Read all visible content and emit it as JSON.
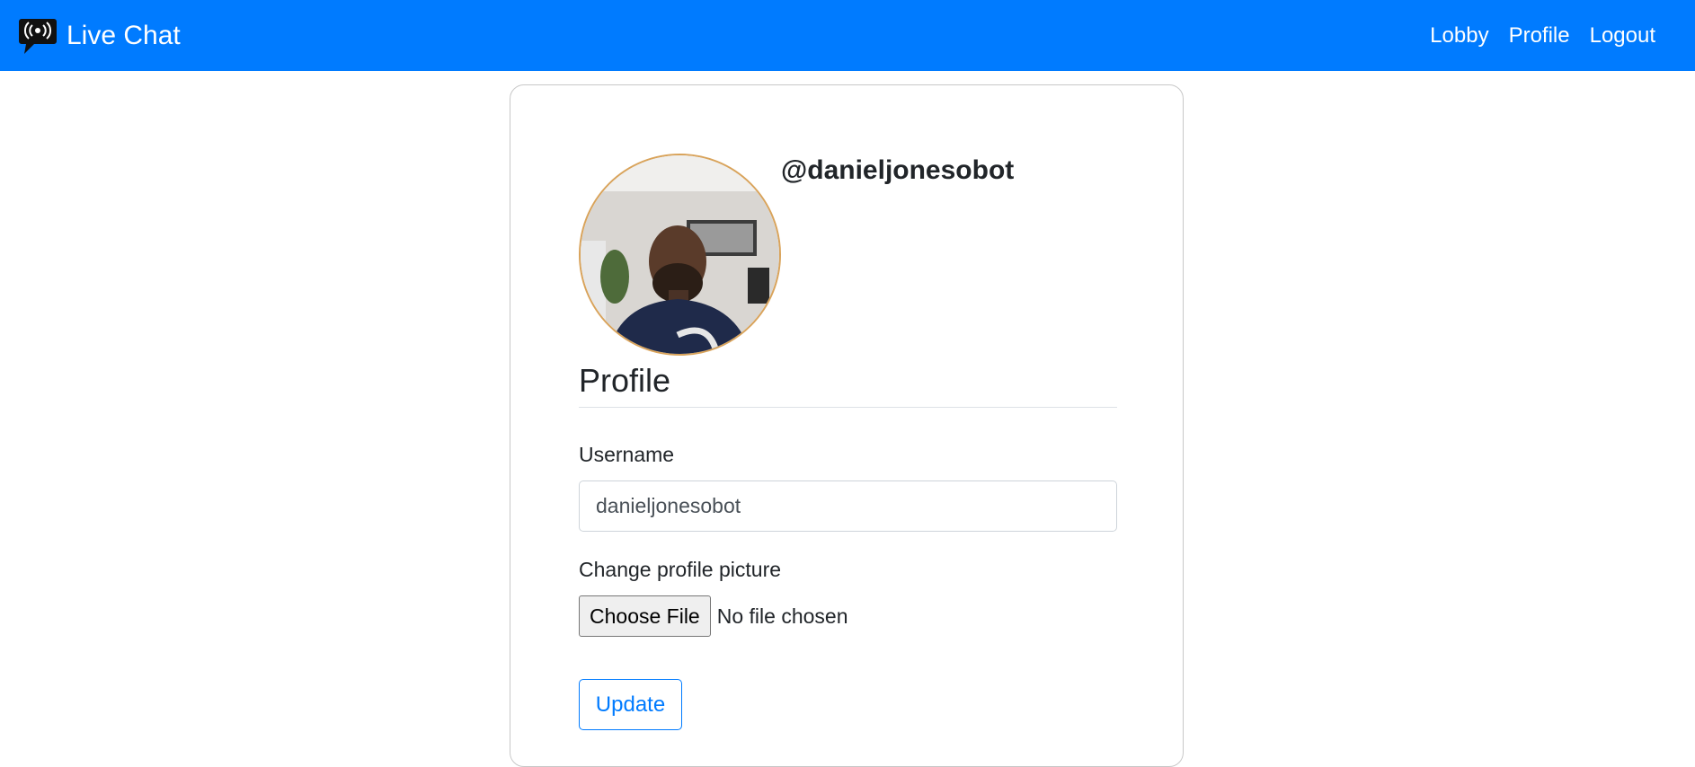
{
  "navbar": {
    "brand": "Live Chat",
    "brand_icon": "broadcast-chat-icon",
    "background": "#007bff",
    "links": [
      "Lobby",
      "Profile",
      "Logout"
    ]
  },
  "profile": {
    "handle": "@danieljonesobot",
    "avatar_icon": "user-avatar-photo",
    "section_title": "Profile",
    "username_label": "Username",
    "username_value": "danieljonesobot",
    "picture_label": "Change profile picture",
    "file_button": "Choose File",
    "file_status": "No file chosen",
    "update_button": "Update"
  },
  "colors": {
    "accent": "#007bff"
  }
}
